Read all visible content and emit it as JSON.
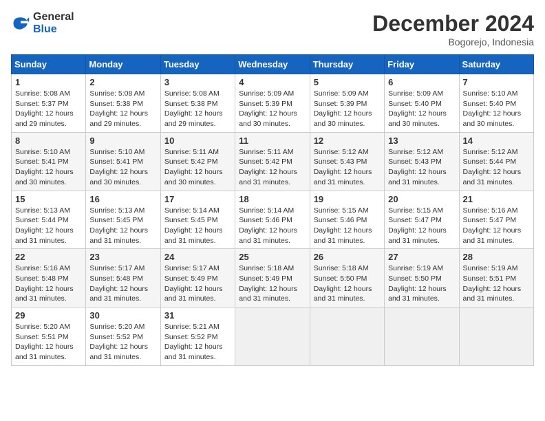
{
  "header": {
    "logo_general": "General",
    "logo_blue": "Blue",
    "month_title": "December 2024",
    "location": "Bogorejo, Indonesia"
  },
  "weekdays": [
    "Sunday",
    "Monday",
    "Tuesday",
    "Wednesday",
    "Thursday",
    "Friday",
    "Saturday"
  ],
  "weeks": [
    [
      {
        "day": "1",
        "sunrise": "5:08 AM",
        "sunset": "5:37 PM",
        "daylight": "12 hours and 29 minutes."
      },
      {
        "day": "2",
        "sunrise": "5:08 AM",
        "sunset": "5:38 PM",
        "daylight": "12 hours and 29 minutes."
      },
      {
        "day": "3",
        "sunrise": "5:08 AM",
        "sunset": "5:38 PM",
        "daylight": "12 hours and 29 minutes."
      },
      {
        "day": "4",
        "sunrise": "5:09 AM",
        "sunset": "5:39 PM",
        "daylight": "12 hours and 30 minutes."
      },
      {
        "day": "5",
        "sunrise": "5:09 AM",
        "sunset": "5:39 PM",
        "daylight": "12 hours and 30 minutes."
      },
      {
        "day": "6",
        "sunrise": "5:09 AM",
        "sunset": "5:40 PM",
        "daylight": "12 hours and 30 minutes."
      },
      {
        "day": "7",
        "sunrise": "5:10 AM",
        "sunset": "5:40 PM",
        "daylight": "12 hours and 30 minutes."
      }
    ],
    [
      {
        "day": "8",
        "sunrise": "5:10 AM",
        "sunset": "5:41 PM",
        "daylight": "12 hours and 30 minutes."
      },
      {
        "day": "9",
        "sunrise": "5:10 AM",
        "sunset": "5:41 PM",
        "daylight": "12 hours and 30 minutes."
      },
      {
        "day": "10",
        "sunrise": "5:11 AM",
        "sunset": "5:42 PM",
        "daylight": "12 hours and 30 minutes."
      },
      {
        "day": "11",
        "sunrise": "5:11 AM",
        "sunset": "5:42 PM",
        "daylight": "12 hours and 31 minutes."
      },
      {
        "day": "12",
        "sunrise": "5:12 AM",
        "sunset": "5:43 PM",
        "daylight": "12 hours and 31 minutes."
      },
      {
        "day": "13",
        "sunrise": "5:12 AM",
        "sunset": "5:43 PM",
        "daylight": "12 hours and 31 minutes."
      },
      {
        "day": "14",
        "sunrise": "5:12 AM",
        "sunset": "5:44 PM",
        "daylight": "12 hours and 31 minutes."
      }
    ],
    [
      {
        "day": "15",
        "sunrise": "5:13 AM",
        "sunset": "5:44 PM",
        "daylight": "12 hours and 31 minutes."
      },
      {
        "day": "16",
        "sunrise": "5:13 AM",
        "sunset": "5:45 PM",
        "daylight": "12 hours and 31 minutes."
      },
      {
        "day": "17",
        "sunrise": "5:14 AM",
        "sunset": "5:45 PM",
        "daylight": "12 hours and 31 minutes."
      },
      {
        "day": "18",
        "sunrise": "5:14 AM",
        "sunset": "5:46 PM",
        "daylight": "12 hours and 31 minutes."
      },
      {
        "day": "19",
        "sunrise": "5:15 AM",
        "sunset": "5:46 PM",
        "daylight": "12 hours and 31 minutes."
      },
      {
        "day": "20",
        "sunrise": "5:15 AM",
        "sunset": "5:47 PM",
        "daylight": "12 hours and 31 minutes."
      },
      {
        "day": "21",
        "sunrise": "5:16 AM",
        "sunset": "5:47 PM",
        "daylight": "12 hours and 31 minutes."
      }
    ],
    [
      {
        "day": "22",
        "sunrise": "5:16 AM",
        "sunset": "5:48 PM",
        "daylight": "12 hours and 31 minutes."
      },
      {
        "day": "23",
        "sunrise": "5:17 AM",
        "sunset": "5:48 PM",
        "daylight": "12 hours and 31 minutes."
      },
      {
        "day": "24",
        "sunrise": "5:17 AM",
        "sunset": "5:49 PM",
        "daylight": "12 hours and 31 minutes."
      },
      {
        "day": "25",
        "sunrise": "5:18 AM",
        "sunset": "5:49 PM",
        "daylight": "12 hours and 31 minutes."
      },
      {
        "day": "26",
        "sunrise": "5:18 AM",
        "sunset": "5:50 PM",
        "daylight": "12 hours and 31 minutes."
      },
      {
        "day": "27",
        "sunrise": "5:19 AM",
        "sunset": "5:50 PM",
        "daylight": "12 hours and 31 minutes."
      },
      {
        "day": "28",
        "sunrise": "5:19 AM",
        "sunset": "5:51 PM",
        "daylight": "12 hours and 31 minutes."
      }
    ],
    [
      {
        "day": "29",
        "sunrise": "5:20 AM",
        "sunset": "5:51 PM",
        "daylight": "12 hours and 31 minutes."
      },
      {
        "day": "30",
        "sunrise": "5:20 AM",
        "sunset": "5:52 PM",
        "daylight": "12 hours and 31 minutes."
      },
      {
        "day": "31",
        "sunrise": "5:21 AM",
        "sunset": "5:52 PM",
        "daylight": "12 hours and 31 minutes."
      },
      null,
      null,
      null,
      null
    ]
  ]
}
